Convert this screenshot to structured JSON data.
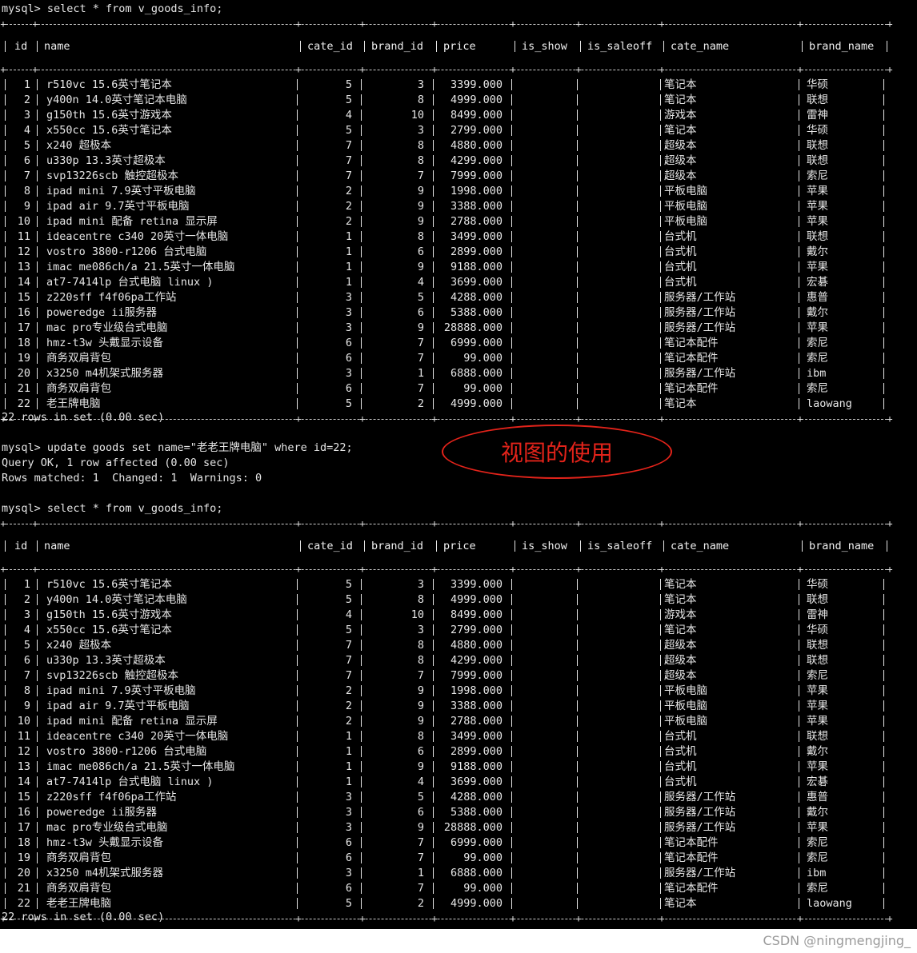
{
  "commands": {
    "select1": "mysql> select * from v_goods_info;",
    "summary1": "22 rows in set (0.00 sec)",
    "update": "mysql> update goods set name=\"老老王牌电脑\" where id=22;",
    "query_ok": "Query OK, 1 row affected (0.00 sec)",
    "rows_matched": "Rows matched: 1  Changed: 1  Warnings: 0",
    "select2": "mysql> select * from v_goods_info;",
    "summary2": "22 rows in set (0.00 sec)"
  },
  "columns": [
    "id",
    "name",
    "cate_id",
    "brand_id",
    "price",
    "is_show",
    "is_saleoff",
    "cate_name",
    "brand_name"
  ],
  "table1": [
    [
      "1",
      "r510vc 15.6英寸笔记本",
      "5",
      "3",
      "3399.000",
      "",
      "",
      "笔记本",
      "华硕"
    ],
    [
      "2",
      "y400n 14.0英寸笔记本电脑",
      "5",
      "8",
      "4999.000",
      "",
      "",
      "笔记本",
      "联想"
    ],
    [
      "3",
      "g150th 15.6英寸游戏本",
      "4",
      "10",
      "8499.000",
      "",
      "",
      "游戏本",
      "雷神"
    ],
    [
      "4",
      "x550cc 15.6英寸笔记本",
      "5",
      "3",
      "2799.000",
      "",
      "",
      "笔记本",
      "华硕"
    ],
    [
      "5",
      "x240 超极本",
      "7",
      "8",
      "4880.000",
      "",
      "",
      "超级本",
      "联想"
    ],
    [
      "6",
      "u330p 13.3英寸超极本",
      "7",
      "8",
      "4299.000",
      "",
      "",
      "超级本",
      "联想"
    ],
    [
      "7",
      "svp13226scb 触控超极本",
      "7",
      "7",
      "7999.000",
      "",
      "",
      "超级本",
      "索尼"
    ],
    [
      "8",
      "ipad mini 7.9英寸平板电脑",
      "2",
      "9",
      "1998.000",
      "",
      "",
      "平板电脑",
      "苹果"
    ],
    [
      "9",
      "ipad air 9.7英寸平板电脑",
      "2",
      "9",
      "3388.000",
      "",
      "",
      "平板电脑",
      "苹果"
    ],
    [
      "10",
      "ipad mini 配备 retina 显示屏",
      "2",
      "9",
      "2788.000",
      "",
      "",
      "平板电脑",
      "苹果"
    ],
    [
      "11",
      "ideacentre c340 20英寸一体电脑",
      "1",
      "8",
      "3499.000",
      "",
      "",
      "台式机",
      "联想"
    ],
    [
      "12",
      "vostro 3800-r1206 台式电脑",
      "1",
      "6",
      "2899.000",
      "",
      "",
      "台式机",
      "戴尔"
    ],
    [
      "13",
      "imac me086ch/a 21.5英寸一体电脑",
      "1",
      "9",
      "9188.000",
      "",
      "",
      "台式机",
      "苹果"
    ],
    [
      "14",
      "at7-7414lp 台式电脑 linux )",
      "1",
      "4",
      "3699.000",
      "",
      "",
      "台式机",
      "宏碁"
    ],
    [
      "15",
      "z220sff f4f06pa工作站",
      "3",
      "5",
      "4288.000",
      "",
      "",
      "服务器/工作站",
      "惠普"
    ],
    [
      "16",
      "poweredge ii服务器",
      "3",
      "6",
      "5388.000",
      "",
      "",
      "服务器/工作站",
      "戴尔"
    ],
    [
      "17",
      "mac pro专业级台式电脑",
      "3",
      "9",
      "28888.000",
      "",
      "",
      "服务器/工作站",
      "苹果"
    ],
    [
      "18",
      "hmz-t3w 头戴显示设备",
      "6",
      "7",
      "6999.000",
      "",
      "",
      "笔记本配件",
      "索尼"
    ],
    [
      "19",
      "商务双肩背包",
      "6",
      "7",
      "99.000",
      "",
      "",
      "笔记本配件",
      "索尼"
    ],
    [
      "20",
      "x3250 m4机架式服务器",
      "3",
      "1",
      "6888.000",
      "",
      "",
      "服务器/工作站",
      "ibm"
    ],
    [
      "21",
      "商务双肩背包",
      "6",
      "7",
      "99.000",
      "",
      "",
      "笔记本配件",
      "索尼"
    ],
    [
      "22",
      "老王牌电脑",
      "5",
      "2",
      "4999.000",
      "",
      "",
      "笔记本",
      "laowang"
    ]
  ],
  "table2": [
    [
      "1",
      "r510vc 15.6英寸笔记本",
      "5",
      "3",
      "3399.000",
      "",
      "",
      "笔记本",
      "华硕"
    ],
    [
      "2",
      "y400n 14.0英寸笔记本电脑",
      "5",
      "8",
      "4999.000",
      "",
      "",
      "笔记本",
      "联想"
    ],
    [
      "3",
      "g150th 15.6英寸游戏本",
      "4",
      "10",
      "8499.000",
      "",
      "",
      "游戏本",
      "雷神"
    ],
    [
      "4",
      "x550cc 15.6英寸笔记本",
      "5",
      "3",
      "2799.000",
      "",
      "",
      "笔记本",
      "华硕"
    ],
    [
      "5",
      "x240 超极本",
      "7",
      "8",
      "4880.000",
      "",
      "",
      "超级本",
      "联想"
    ],
    [
      "6",
      "u330p 13.3英寸超极本",
      "7",
      "8",
      "4299.000",
      "",
      "",
      "超级本",
      "联想"
    ],
    [
      "7",
      "svp13226scb 触控超极本",
      "7",
      "7",
      "7999.000",
      "",
      "",
      "超级本",
      "索尼"
    ],
    [
      "8",
      "ipad mini 7.9英寸平板电脑",
      "2",
      "9",
      "1998.000",
      "",
      "",
      "平板电脑",
      "苹果"
    ],
    [
      "9",
      "ipad air 9.7英寸平板电脑",
      "2",
      "9",
      "3388.000",
      "",
      "",
      "平板电脑",
      "苹果"
    ],
    [
      "10",
      "ipad mini 配备 retina 显示屏",
      "2",
      "9",
      "2788.000",
      "",
      "",
      "平板电脑",
      "苹果"
    ],
    [
      "11",
      "ideacentre c340 20英寸一体电脑",
      "1",
      "8",
      "3499.000",
      "",
      "",
      "台式机",
      "联想"
    ],
    [
      "12",
      "vostro 3800-r1206 台式电脑",
      "1",
      "6",
      "2899.000",
      "",
      "",
      "台式机",
      "戴尔"
    ],
    [
      "13",
      "imac me086ch/a 21.5英寸一体电脑",
      "1",
      "9",
      "9188.000",
      "",
      "",
      "台式机",
      "苹果"
    ],
    [
      "14",
      "at7-7414lp 台式电脑 linux )",
      "1",
      "4",
      "3699.000",
      "",
      "",
      "台式机",
      "宏碁"
    ],
    [
      "15",
      "z220sff f4f06pa工作站",
      "3",
      "5",
      "4288.000",
      "",
      "",
      "服务器/工作站",
      "惠普"
    ],
    [
      "16",
      "poweredge ii服务器",
      "3",
      "6",
      "5388.000",
      "",
      "",
      "服务器/工作站",
      "戴尔"
    ],
    [
      "17",
      "mac pro专业级台式电脑",
      "3",
      "9",
      "28888.000",
      "",
      "",
      "服务器/工作站",
      "苹果"
    ],
    [
      "18",
      "hmz-t3w 头戴显示设备",
      "6",
      "7",
      "6999.000",
      "",
      "",
      "笔记本配件",
      "索尼"
    ],
    [
      "19",
      "商务双肩背包",
      "6",
      "7",
      "99.000",
      "",
      "",
      "笔记本配件",
      "索尼"
    ],
    [
      "20",
      "x3250 m4机架式服务器",
      "3",
      "1",
      "6888.000",
      "",
      "",
      "服务器/工作站",
      "ibm"
    ],
    [
      "21",
      "商务双肩背包",
      "6",
      "7",
      "99.000",
      "",
      "",
      "笔记本配件",
      "索尼"
    ],
    [
      "22",
      "老老王牌电脑",
      "5",
      "2",
      "4999.000",
      "",
      "",
      "笔记本",
      "laowang"
    ]
  ],
  "annotation": {
    "text": "视图的使用",
    "color": "#e2231a"
  },
  "watermark": "CSDN @ningmengjing_"
}
